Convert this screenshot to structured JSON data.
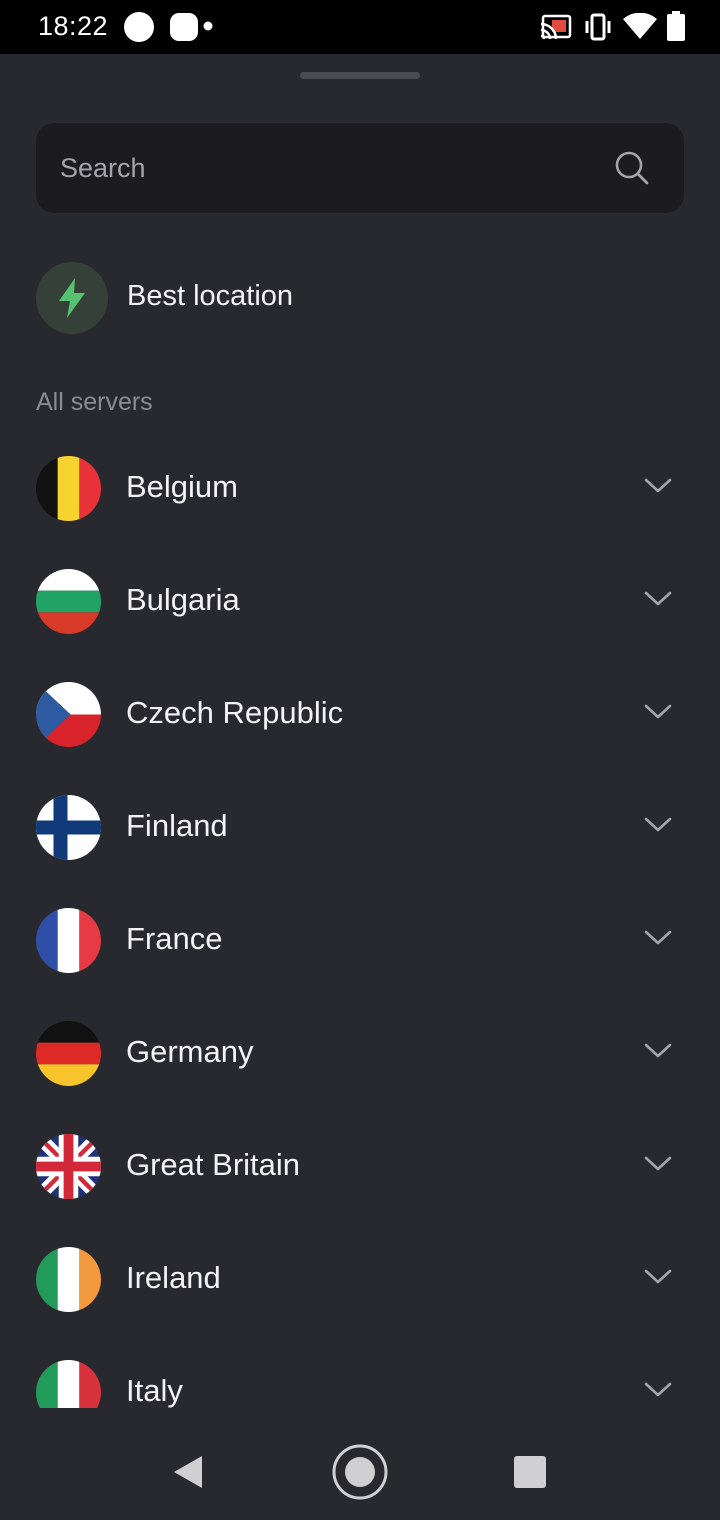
{
  "status_bar": {
    "time": "18:22",
    "icons": [
      "notification-dot-icon",
      "notification-app-icon",
      "more-notifications-dot-icon",
      "cast-icon",
      "vibrate-icon",
      "wifi-icon",
      "battery-icon"
    ]
  },
  "search": {
    "placeholder": "Search",
    "value": ""
  },
  "best_location": {
    "label": "Best location",
    "icon": "bolt-icon",
    "accent": "#56c271"
  },
  "section_label": "All servers",
  "countries": [
    {
      "name": "Belgium",
      "flag": "belgium-flag-icon"
    },
    {
      "name": "Bulgaria",
      "flag": "bulgaria-flag-icon"
    },
    {
      "name": "Czech Republic",
      "flag": "czech-republic-flag-icon"
    },
    {
      "name": "Finland",
      "flag": "finland-flag-icon"
    },
    {
      "name": "France",
      "flag": "france-flag-icon"
    },
    {
      "name": "Germany",
      "flag": "germany-flag-icon"
    },
    {
      "name": "Great Britain",
      "flag": "great-britain-flag-icon"
    },
    {
      "name": "Ireland",
      "flag": "ireland-flag-icon"
    },
    {
      "name": "Italy",
      "flag": "italy-flag-icon"
    }
  ],
  "colors": {
    "background": "#28292f",
    "search_background": "#1c1c20",
    "text_primary": "#f3f3f5",
    "text_secondary": "#8b8c92"
  },
  "nav_bar": {
    "icons": [
      "back-icon",
      "home-icon",
      "recents-icon"
    ]
  }
}
